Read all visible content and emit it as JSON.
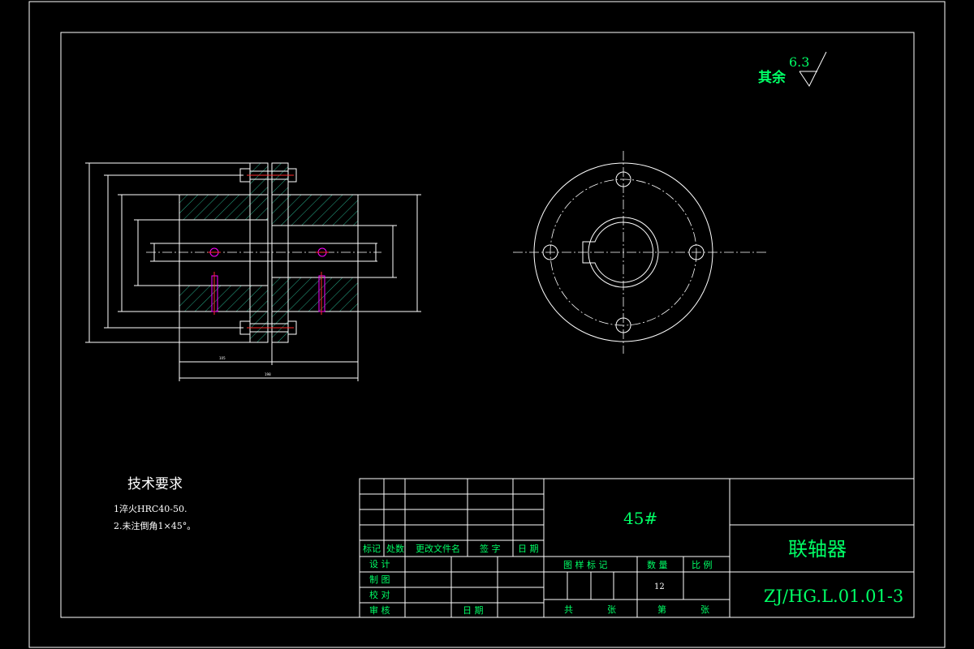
{
  "roughness": {
    "other_label": "其余",
    "value": "6.3"
  },
  "tech_requirements": {
    "title": "技术要求",
    "items": [
      "1淬火HRC40-50.",
      "2.未注倒角1×45°。"
    ]
  },
  "title_block": {
    "material": "45#",
    "part_name": "联轴器",
    "drawing_number": "ZJ/HG.L.01.01-3",
    "revision_headers": [
      "标记",
      "处数",
      "更改文件名",
      "签 字",
      "日 期"
    ],
    "roles": [
      "设 计",
      "制 图",
      "校 对",
      "审 核"
    ],
    "date_label": "日 期",
    "stage_label": "图 样 标 记",
    "quantity_label": "数 量",
    "scale_label": "比 例",
    "quantity_value": "12",
    "total_label": "共",
    "sheet_label": "张",
    "page_label": "第",
    "page_sheet_label": "张"
  },
  "dimensions": [
    "105",
    "198"
  ]
}
